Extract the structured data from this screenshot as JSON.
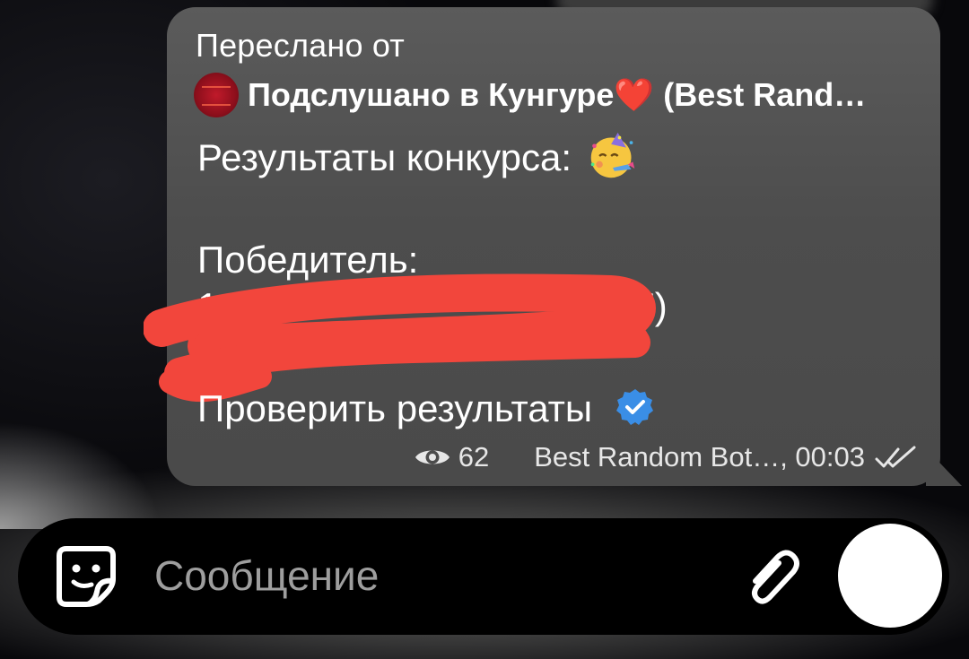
{
  "message": {
    "forwarded_label": "Переслано от",
    "channel_name": "Подслушано в Кунгуре❤️ (Best Rand…",
    "results_title": "Результаты конкурса:",
    "winner_label": "Победитель:",
    "winner_fragment_start": "1.",
    "winner_fragment_end": "7)",
    "check_results": "Проверить результаты",
    "views": "62",
    "author_time": "Best Random Bot…, 00:03"
  },
  "composer": {
    "placeholder": "Сообщение"
  },
  "icons": {
    "emoji": "partying-face-icon",
    "verified": "verified-check-icon",
    "views": "eye-icon",
    "status": "double-check-icon",
    "sticker": "sticker-icon",
    "attach": "paperclip-icon"
  },
  "colors": {
    "bubble": "#555555",
    "verified": "#3a8ee6",
    "redaction": "#f2463c",
    "input_bar": "#000000",
    "send_button": "#ffffff"
  }
}
